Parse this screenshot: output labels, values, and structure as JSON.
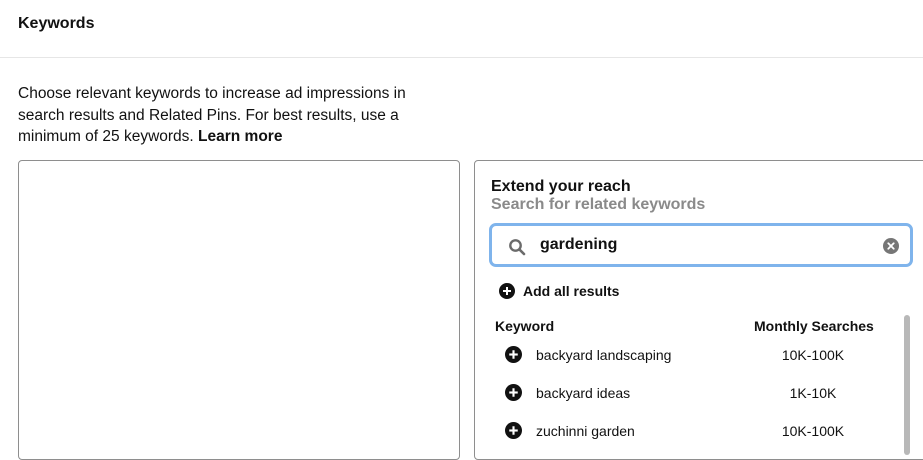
{
  "header": {
    "title": "Keywords"
  },
  "description": {
    "text": "Choose relevant keywords to increase ad impressions in search results and Related Pins. For best results, use a minimum of 25 keywords.",
    "learn_more": "Learn more"
  },
  "extend": {
    "title": "Extend your reach",
    "subtitle": "Search for related keywords"
  },
  "search": {
    "value": "gardening",
    "icon": "search-icon",
    "clear_icon": "clear-icon"
  },
  "add_all": {
    "label": "Add all results",
    "icon": "plus-circle-icon"
  },
  "table": {
    "columns": [
      "Keyword",
      "Monthly Searches"
    ],
    "rows": [
      {
        "keyword": "backyard landscaping",
        "monthly_searches": "10K-100K"
      },
      {
        "keyword": "backyard ideas",
        "monthly_searches": "1K-10K"
      },
      {
        "keyword": "zuchinni garden",
        "monthly_searches": "10K-100K"
      }
    ]
  },
  "colors": {
    "search_focus_border": "#7fb4ec",
    "subtitle_gray": "#8a8a8a",
    "box_border": "#8e8e8e"
  }
}
